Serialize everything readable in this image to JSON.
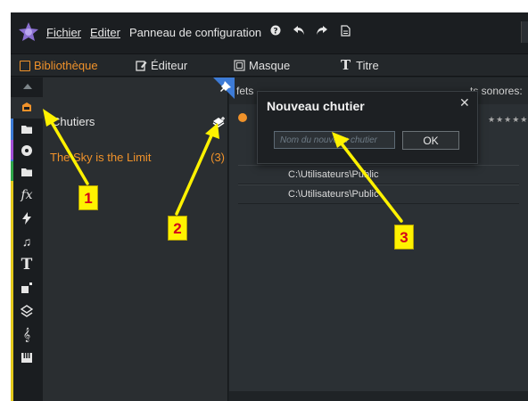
{
  "menubar": {
    "items": [
      {
        "label": "Fichier"
      },
      {
        "label": "Editer"
      },
      {
        "label": "Panneau de configuration"
      }
    ],
    "icons": [
      "help-icon",
      "undo-icon",
      "redo-icon",
      "document-icon"
    ]
  },
  "tabs": [
    {
      "label": "Bibliothèque",
      "active": true
    },
    {
      "label": "Éditeur",
      "active": false
    },
    {
      "label": "Masque",
      "active": false
    },
    {
      "label": "Titre",
      "active": false
    }
  ],
  "bins": {
    "header": "Chutiers",
    "items": [
      {
        "label": "The Sky is the Limit",
        "count": "(3)"
      }
    ]
  },
  "library": {
    "tab_left": "fets",
    "tab_right": "ts sonores: (",
    "stars": "★★★★★",
    "paths": [
      "C:\\Utilisateurs\\Public",
      "C:\\Utilisateurs\\Public"
    ]
  },
  "dialog": {
    "title": "Nouveau chutier",
    "close": "✕",
    "input_placeholder": "Nom du nouveau chutier",
    "input_value": "",
    "ok_label": "OK"
  },
  "annotations": [
    "1",
    "2",
    "3"
  ],
  "colors": {
    "accent": "#f0922a",
    "annotation_yellow": "#fff200",
    "annotation_text": "#d2001a",
    "strip_colors": [
      "#f0922a",
      "#3d7bd6",
      "#a24fd6",
      "#2fa64a",
      "#e3c81b"
    ]
  }
}
